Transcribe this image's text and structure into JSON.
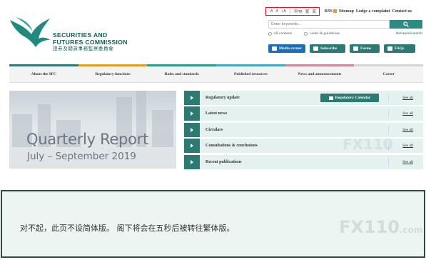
{
  "header": {
    "logo_line1": "SECURITIES AND",
    "logo_line2": "FUTURES COMMISSION",
    "logo_line3": "證券及期貨事務監察委員會"
  },
  "utility": {
    "font_small": "-A",
    "font_medium": "A",
    "font_large": "+A",
    "lang_en": "Eng",
    "lang_tc": "繁",
    "lang_sc": "简",
    "rss": "RSS",
    "sitemap": "Sitemap",
    "complaint": "Lodge a complaint",
    "contact": "Contact us"
  },
  "search": {
    "placeholder": "Enter keywords...",
    "opt_all": "all contents",
    "opt_codes": "codes & guidelines",
    "advanced": "Advanced search"
  },
  "quick_buttons": {
    "media": "Media corner",
    "subscribe": "Subscribe",
    "forms": "Forms",
    "faqs": "FAQs"
  },
  "nav": [
    {
      "label": "About the SFC",
      "color": "#2c7a73"
    },
    {
      "label": "Regulatory functions",
      "color": "#e0a02a"
    },
    {
      "label": "Rules and standards",
      "color": "#2a9d8f"
    },
    {
      "label": "Published resources",
      "color": "#4aa6c8"
    },
    {
      "label": "News and announcements",
      "color": "#c98aa0"
    },
    {
      "label": "Career",
      "color": "#d4d4d4"
    }
  ],
  "banner": {
    "title": "Quarterly Report",
    "subtitle": "July – September 2019"
  },
  "right_list": [
    {
      "label": "Regulatory update",
      "see_all": "See all",
      "calendar": "Regulatory Calendar"
    },
    {
      "label": "Latest news",
      "see_all": "See all"
    },
    {
      "label": "Circulars",
      "see_all": "See all"
    },
    {
      "label": "Consultations & conclusions",
      "see_all": "See all"
    },
    {
      "label": "Recent publications",
      "see_all": "See all"
    }
  ],
  "notice": {
    "text": "对不起，此页不设简体版。 阁下将会在五秒后被转往繁体版。"
  },
  "watermark": {
    "text": "FX110",
    "suffix": ".com"
  },
  "colors": {
    "brand": "#2c7a73",
    "highlight": "#e4121d",
    "notice_border": "#2f4b46"
  }
}
